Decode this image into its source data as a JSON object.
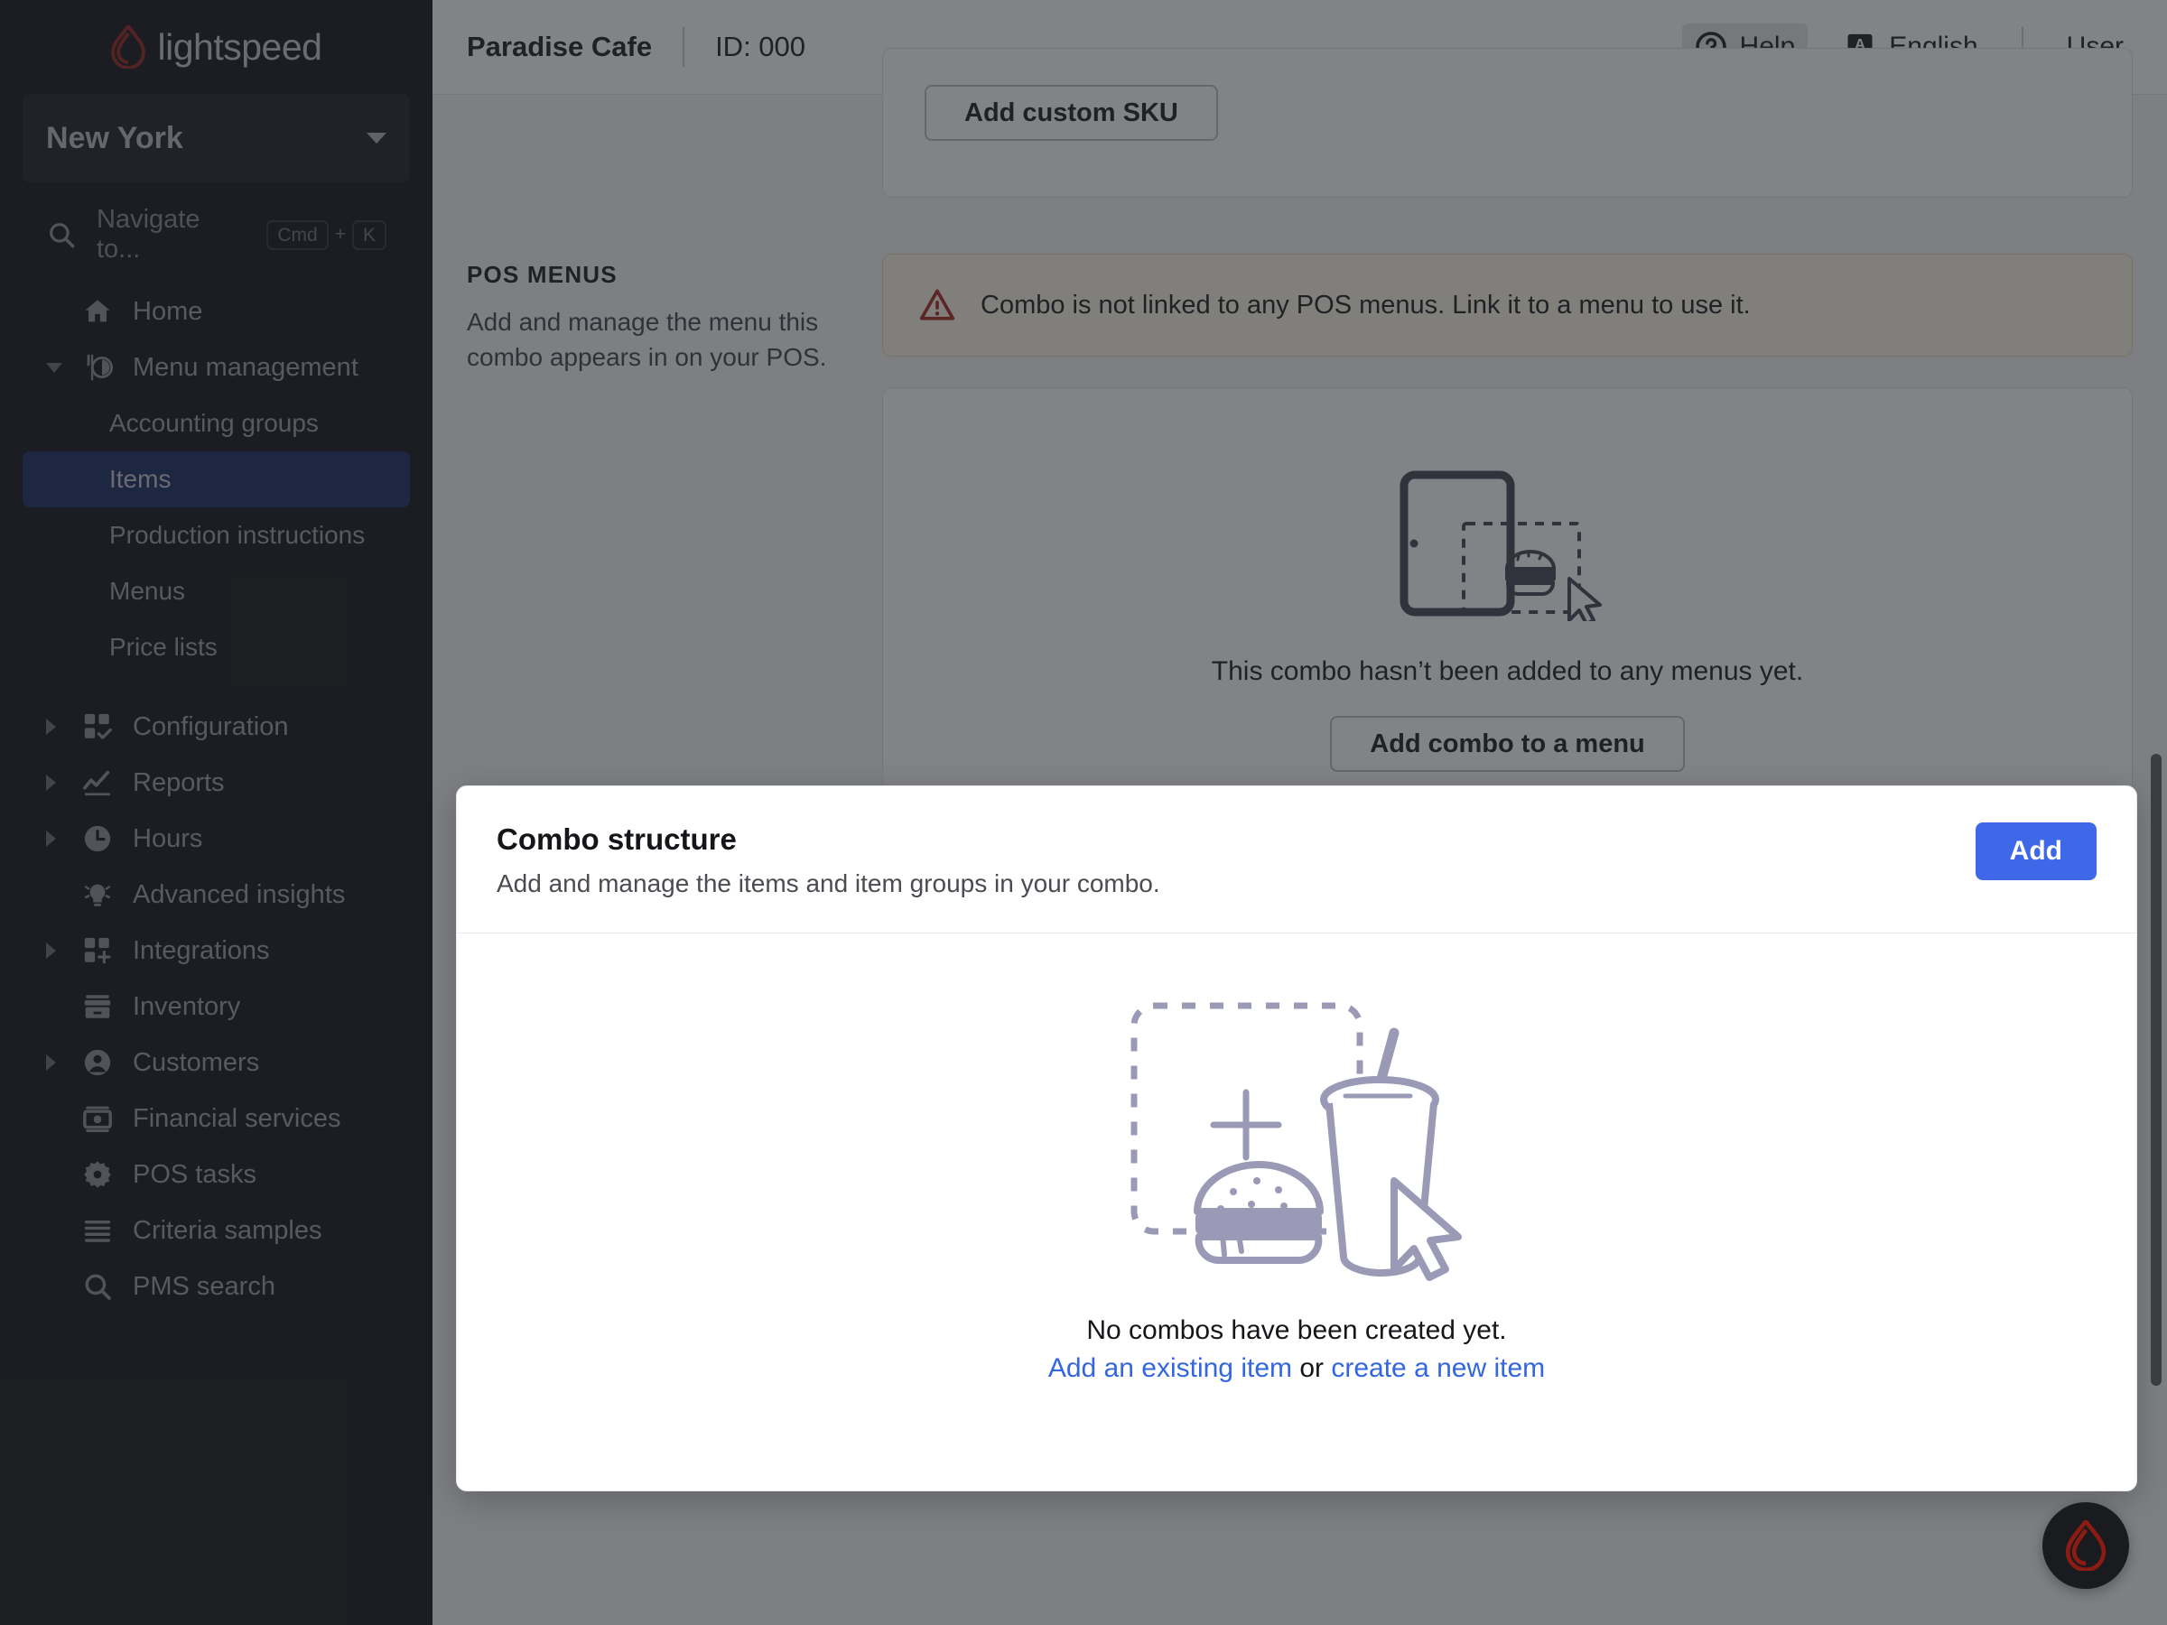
{
  "brand": {
    "name": "lightspeed",
    "flame_color": "#8c1b13"
  },
  "sidebar": {
    "location": "New York",
    "search_placeholder": "Navigate to...",
    "shortcut": {
      "key1": "Cmd",
      "plus": "+",
      "key2": "K"
    },
    "items": [
      {
        "label": "Home",
        "icon": "home-icon",
        "level": 0,
        "twisty": "none",
        "active": false
      },
      {
        "label": "Menu management",
        "icon": "menu-management-icon",
        "level": 0,
        "twisty": "down",
        "active": false
      },
      {
        "label": "Accounting groups",
        "icon": "none",
        "level": 1,
        "twisty": "none",
        "active": false
      },
      {
        "label": "Items",
        "icon": "none",
        "level": 1,
        "twisty": "none",
        "active": true
      },
      {
        "label": "Production instructions",
        "icon": "none",
        "level": 1,
        "twisty": "none",
        "active": false
      },
      {
        "label": "Menus",
        "icon": "none",
        "level": 1,
        "twisty": "none",
        "active": false
      },
      {
        "label": "Price lists",
        "icon": "none",
        "level": 1,
        "twisty": "none",
        "active": false
      },
      {
        "label": "Configuration",
        "icon": "grid-check-icon",
        "level": 0,
        "twisty": "right",
        "active": false
      },
      {
        "label": "Reports",
        "icon": "chart-line-icon",
        "level": 0,
        "twisty": "right",
        "active": false
      },
      {
        "label": "Hours",
        "icon": "clock-icon",
        "level": 0,
        "twisty": "right",
        "active": false
      },
      {
        "label": "Advanced insights",
        "icon": "lightbulb-icon",
        "level": 0,
        "twisty": "none",
        "active": false
      },
      {
        "label": "Integrations",
        "icon": "grid-plus-icon",
        "level": 0,
        "twisty": "right",
        "active": false
      },
      {
        "label": "Inventory",
        "icon": "inventory-box-icon",
        "level": 0,
        "twisty": "none",
        "active": false
      },
      {
        "label": "Customers",
        "icon": "user-circle-icon",
        "level": 0,
        "twisty": "right",
        "active": false
      },
      {
        "label": "Financial services",
        "icon": "banknote-icon",
        "level": 0,
        "twisty": "none",
        "active": false
      },
      {
        "label": "POS tasks",
        "icon": "gear-icon",
        "level": 0,
        "twisty": "none",
        "active": false
      },
      {
        "label": "Criteria samples",
        "icon": "list-lines-icon",
        "level": 0,
        "twisty": "none",
        "active": false
      },
      {
        "label": "PMS search",
        "icon": "search-icon",
        "level": 0,
        "twisty": "none",
        "active": false
      }
    ]
  },
  "topbar": {
    "business": "Paradise Cafe",
    "id": "ID: 000",
    "help": "Help",
    "language": "English",
    "language_badge": "A",
    "user": "User"
  },
  "sku_section": {
    "button": "Add custom SKU"
  },
  "pos_menus": {
    "title": "POS MENUS",
    "description": "Add and manage the menu this combo appears in on your POS.",
    "alert": "Combo is not linked to any POS menus. Link it to a menu to use it.",
    "empty_text": "This combo hasn’t been added to any menus yet.",
    "empty_button": "Add combo to a menu"
  },
  "combo_modal": {
    "title": "Combo structure",
    "subtitle": "Add and manage the items and item groups in your combo.",
    "add_button": "Add",
    "empty_text": "No combos have been created yet.",
    "link_existing": "Add an existing item",
    "link_or": " or ",
    "link_new": "create a new item"
  },
  "colors": {
    "accent_blue": "#3f68e8",
    "link_blue": "#3366e0",
    "active_nav": "#11255c",
    "alert_bg": "#fdf5e6",
    "warn_red": "#a32318"
  }
}
